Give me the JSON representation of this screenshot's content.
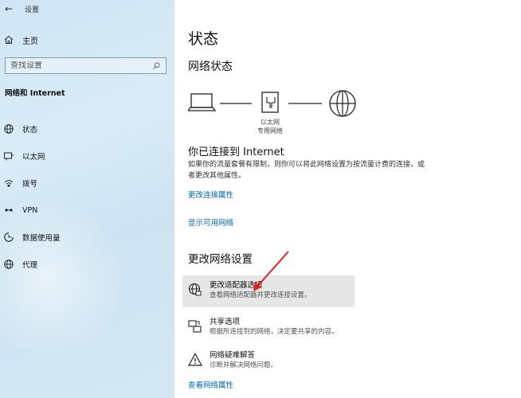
{
  "window": {
    "title": "设置"
  },
  "sidebar": {
    "home_label": "主页",
    "search_placeholder": "查找设置",
    "section_title": "网络和 Internet",
    "items": [
      {
        "label": "状态",
        "icon": "status-globe-icon"
      },
      {
        "label": "以太网",
        "icon": "ethernet-icon"
      },
      {
        "label": "拨号",
        "icon": "dial-up-icon"
      },
      {
        "label": "VPN",
        "icon": "vpn-icon"
      },
      {
        "label": "数据使用量",
        "icon": "data-usage-icon"
      },
      {
        "label": "代理",
        "icon": "proxy-globe-icon"
      }
    ]
  },
  "main": {
    "page_title": "状态",
    "network_status_heading": "网络状态",
    "diagram": {
      "adapter_name": "以太网",
      "network_type": "专用网络"
    },
    "connected_heading": "你已连接到 Internet",
    "connected_desc": "如果你的流量套餐有限制，则你可以将此网络设置为按流量计费的连接，或者更改其他属性。",
    "link_change_props": "更改连接属性",
    "link_show_networks": "显示可用网络",
    "change_settings_heading": "更改网络设置",
    "options": [
      {
        "title": "更改适配器选项",
        "desc": "查看网络适配器并更改连接设置。",
        "icon": "adapter-options-icon",
        "highlighted": true
      },
      {
        "title": "共享选项",
        "desc": "根据所连接到的网络，决定要共享的内容。",
        "icon": "sharing-icon",
        "highlighted": false
      },
      {
        "title": "网络疑难解答",
        "desc": "诊断并解决网络问题。",
        "icon": "warning-triangle-icon",
        "highlighted": false
      }
    ],
    "link_view_properties": "查看网络属性"
  },
  "colors": {
    "accent": "#0067c0",
    "annotation_arrow": "#e02020",
    "sidebar_bg": "#d4e8f4",
    "highlight_bg": "#e6e6e6"
  }
}
